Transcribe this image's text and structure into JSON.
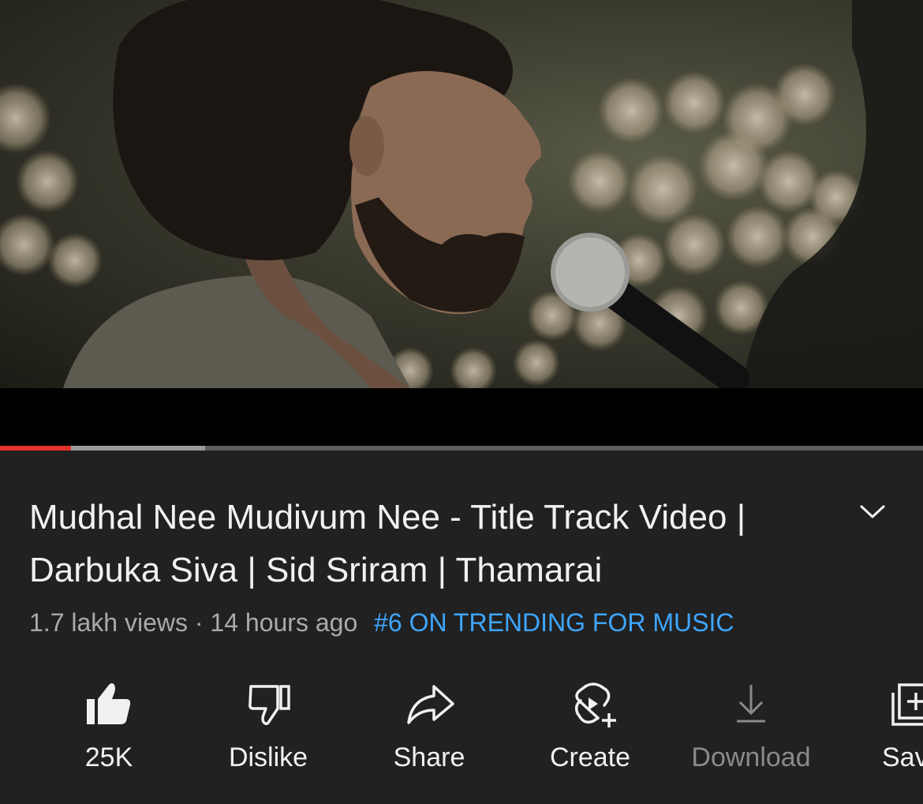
{
  "video": {
    "description_icon": "music-video-thumbnail",
    "progress_played": 0.077,
    "progress_buffered": 0.222
  },
  "title": "Mudhal Nee Mudivum Nee - Title Track Video | Darbuka Siva | Sid Sriram | Thamarai",
  "meta": {
    "views": "1.7 lakh views",
    "separator": "·",
    "time": "14 hours ago",
    "trending": "#6 ON TRENDING FOR MUSIC"
  },
  "actions": {
    "like": {
      "label": "25K",
      "icon": "thumbs-up-icon"
    },
    "dislike": {
      "label": "Dislike",
      "icon": "thumbs-down-icon"
    },
    "share": {
      "label": "Share",
      "icon": "share-arrow-icon"
    },
    "create": {
      "label": "Create",
      "icon": "create-shorts-icon"
    },
    "download": {
      "label": "Download",
      "icon": "download-icon"
    },
    "save": {
      "label": "Sav",
      "icon": "save-playlist-icon"
    }
  },
  "colors": {
    "background": "#212121",
    "progress_played": "#e5312b",
    "trending": "#3ea6ff",
    "muted_text": "#aaaaaa"
  }
}
